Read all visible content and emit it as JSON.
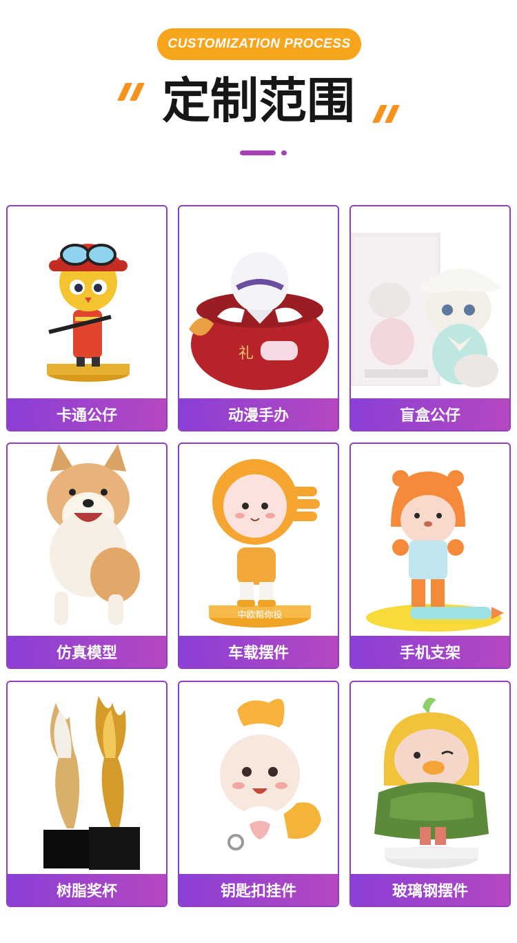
{
  "header": {
    "badge": "CUSTOMIZATION PROCESS",
    "title": "定制范围"
  },
  "colors": {
    "accent_orange": "#f7a51c",
    "accent_purple": "#8f3fbf",
    "label_gradient_start": "#8a3fd6",
    "label_gradient_end": "#b548c0"
  },
  "items": [
    {
      "label": "卡通公仔",
      "icon": "firefighter-bird-figure"
    },
    {
      "label": "动漫手办",
      "icon": "fox-mask-figure"
    },
    {
      "label": "盲盒公仔",
      "icon": "cat-blind-box-figure"
    },
    {
      "label": "仿真模型",
      "icon": "corgi-dog-model"
    },
    {
      "label": "车载摆件",
      "icon": "orange-hood-figure"
    },
    {
      "label": "手机支架",
      "icon": "bear-phone-stand"
    },
    {
      "label": "树脂奖杯",
      "icon": "resin-trophy"
    },
    {
      "label": "钥匙扣挂件",
      "icon": "white-cat-keychain"
    },
    {
      "label": "玻璃钢摆件",
      "icon": "green-hood-duck-figure"
    }
  ]
}
